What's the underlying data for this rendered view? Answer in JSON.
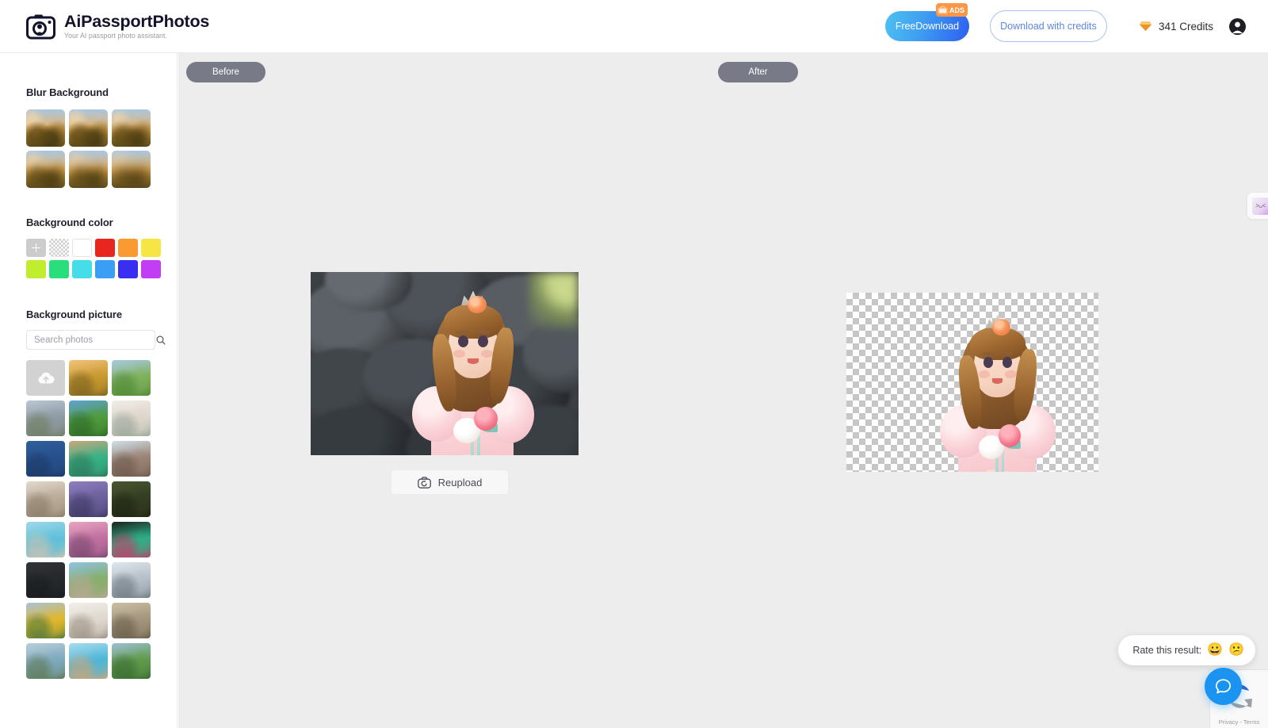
{
  "header": {
    "brand_title": "AiPassportPhotos",
    "brand_subtitle": "Your AI passport photo assistant.",
    "logo_icon": "camera-logo-icon",
    "free_download_label": "FreeDownload",
    "ads_badge_label": "ADS",
    "ads_icon": "tv-ad-icon",
    "download_credits_label": "Download with credits",
    "credits_value": "341 Credits",
    "credits_icon": "gem-icon",
    "avatar_icon": "user-avatar-icon",
    "accent_blue": "#3f9cf2",
    "accent_blue_dark": "#2c5ef0",
    "credits_border": "#a9c2f5",
    "credits_text_color": "#5b86e8",
    "ads_badge_color": "#f99746"
  },
  "sidebar": {
    "blur": {
      "title": "Blur Background",
      "items": [
        {
          "name": "blur-level-1",
          "blur": 0.6
        },
        {
          "name": "blur-level-2",
          "blur": 1.6
        },
        {
          "name": "blur-level-3",
          "blur": 2.8
        },
        {
          "name": "blur-level-4",
          "blur": 4.2
        },
        {
          "name": "blur-level-5",
          "blur": 5.6
        },
        {
          "name": "blur-level-6",
          "blur": 7.0
        }
      ]
    },
    "background_color": {
      "title": "Background color",
      "swatches": [
        {
          "name": "add-custom-color",
          "type": "add",
          "hex": "#cccccc"
        },
        {
          "name": "transparent",
          "type": "transparent",
          "hex": "transparent"
        },
        {
          "name": "white",
          "type": "solid",
          "hex": "#ffffff"
        },
        {
          "name": "red",
          "type": "solid",
          "hex": "#e8251f"
        },
        {
          "name": "orange",
          "type": "solid",
          "hex": "#fa9b32"
        },
        {
          "name": "yellow",
          "type": "solid",
          "hex": "#f5e645"
        },
        {
          "name": "yellow-green",
          "type": "solid",
          "hex": "#c0ee2e"
        },
        {
          "name": "green",
          "type": "solid",
          "hex": "#2ade7c"
        },
        {
          "name": "cyan",
          "type": "solid",
          "hex": "#45dee8"
        },
        {
          "name": "blue",
          "type": "solid",
          "hex": "#3b9ef5"
        },
        {
          "name": "indigo",
          "type": "solid",
          "hex": "#3a2ef0"
        },
        {
          "name": "magenta",
          "type": "solid",
          "hex": "#c13ef5"
        }
      ]
    },
    "background_picture": {
      "title": "Background picture",
      "search_placeholder": "Search photos",
      "search_value": "",
      "search_icon": "search-icon",
      "upload_icon": "cloud-upload-icon",
      "photos": [
        {
          "name": "upload-photo",
          "type": "upload"
        },
        {
          "name": "photo-golden-field-sunset",
          "c1": "#f3c27a",
          "c2": "#c8982f",
          "c3": "#7d6320"
        },
        {
          "name": "photo-lone-tree-green-field",
          "c1": "#a9cbe3",
          "c2": "#7fb05a",
          "c3": "#4f8a36"
        },
        {
          "name": "photo-rocky-mountain-peak",
          "c1": "#b9c8d4",
          "c2": "#8e9aa4",
          "c3": "#6f7e62"
        },
        {
          "name": "photo-green-hills-valley",
          "c1": "#5fa2d8",
          "c2": "#4f9a3c",
          "c3": "#2f6b28"
        },
        {
          "name": "photo-interior-room-plants",
          "c1": "#f0ece6",
          "c2": "#ded6cb",
          "c3": "#9aa79a"
        },
        {
          "name": "photo-full-moon-night-sky",
          "c1": "#2e5f9e",
          "c2": "#27508a",
          "c3": "#1b3a68"
        },
        {
          "name": "photo-green-car-tree",
          "c1": "#c9a77e",
          "c2": "#36b184",
          "c3": "#2d7a5c"
        },
        {
          "name": "photo-desert-plain",
          "c1": "#cfe0ea",
          "c2": "#9a8273",
          "c3": "#6d5a4d"
        },
        {
          "name": "photo-curtains-window",
          "c1": "#e2d8cc",
          "c2": "#b9a996",
          "c3": "#8b7c6b"
        },
        {
          "name": "photo-purple-mountains-dusk",
          "c1": "#8e7fc0",
          "c2": "#6a5f9a",
          "c3": "#3f3a63"
        },
        {
          "name": "photo-dark-oak-tree",
          "c1": "#4a5632",
          "c2": "#333d22",
          "c3": "#1f2614"
        },
        {
          "name": "photo-beach-pier-turquoise",
          "c1": "#9fd8ea",
          "c2": "#5fc0d8",
          "c3": "#c9c2b4"
        },
        {
          "name": "photo-flower-field-sunset",
          "c1": "#e7a4c0",
          "c2": "#c06fa0",
          "c3": "#7a4a70"
        },
        {
          "name": "photo-ferris-wheel-night",
          "c1": "#1b2420",
          "c2": "#2fae86",
          "c3": "#c0406a"
        },
        {
          "name": "photo-blackboard-equations",
          "c1": "#313436",
          "c2": "#25282a",
          "c3": "#1a1d1f"
        },
        {
          "name": "photo-park-pathway-trees",
          "c1": "#8fc3e4",
          "c2": "#87ae6c",
          "c3": "#b7a894"
        },
        {
          "name": "photo-snowy-birch-forest",
          "c1": "#dfe6ec",
          "c2": "#b5bfc7",
          "c3": "#6f7a82"
        },
        {
          "name": "photo-tulip-field",
          "c1": "#a9c3d8",
          "c2": "#e0b62c",
          "c3": "#4f7a3a"
        },
        {
          "name": "photo-white-hallway-arches",
          "c1": "#f2efe9",
          "c2": "#ddd7cd",
          "c3": "#9e9184"
        },
        {
          "name": "photo-stone-columns",
          "c1": "#cbbfa6",
          "c2": "#a3957c",
          "c3": "#6b5f4b"
        },
        {
          "name": "photo-lake-red-house",
          "c1": "#b9cfdb",
          "c2": "#7ea8bd",
          "c3": "#5f7a55"
        },
        {
          "name": "photo-wooden-dock-sea",
          "c1": "#a8dced",
          "c2": "#4fb6d8",
          "c3": "#caa678"
        },
        {
          "name": "photo-green-mountain-range",
          "c1": "#9fc0d6",
          "c2": "#5f9a4a",
          "c3": "#3a6b33"
        }
      ]
    }
  },
  "canvas": {
    "before_label": "Before",
    "after_label": "After",
    "reupload_label": "Reupload",
    "reupload_icon": "camera-refresh-icon",
    "background_hex": "#ededed",
    "pill_hex": "#787a88",
    "side_widget_icon": "emoticon-face-icon",
    "side_widget_glyph": ">ᴗ<"
  },
  "footer": {
    "rate_label": "Rate this result:",
    "emoji_positive": "😀",
    "emoji_negative": "😕",
    "chat_icon": "chat-bubble-icon",
    "chat_color": "#1a94f0",
    "recaptcha_terms": "Privacy - Terms",
    "recaptcha_icon": "recaptcha-icon"
  }
}
